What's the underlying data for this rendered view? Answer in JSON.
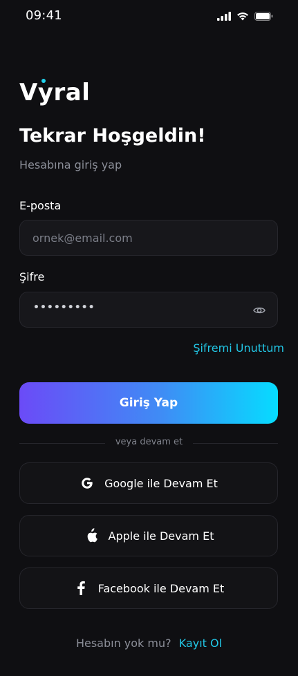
{
  "status_bar": {
    "time": "09:41"
  },
  "brand": {
    "name": "Vyral",
    "accent": "#22d3ee"
  },
  "header": {
    "title": "Tekrar Hoşgeldin!",
    "subtitle": "Hesabına giriş yap"
  },
  "form": {
    "email": {
      "label": "E-posta",
      "placeholder": "ornek@email.com",
      "value": ""
    },
    "password": {
      "label": "Şifre",
      "masked_value": "•••••••••"
    },
    "forgot_link": "Şifremi Unuttum",
    "submit_label": "Giriş Yap"
  },
  "divider": {
    "text": "veya devam et"
  },
  "social": {
    "google_label": "Google ile Devam Et",
    "apple_label": "Apple ile Devam Et",
    "facebook_label": "Facebook ile Devam Et"
  },
  "footer": {
    "prompt": "Hesabın yok mu?",
    "signup_link": "Kayıt Ol"
  },
  "colors": {
    "background": "#0f0f12",
    "link": "#22c7e6",
    "gradient_start": "#6b4bf7",
    "gradient_end": "#06dcff"
  }
}
